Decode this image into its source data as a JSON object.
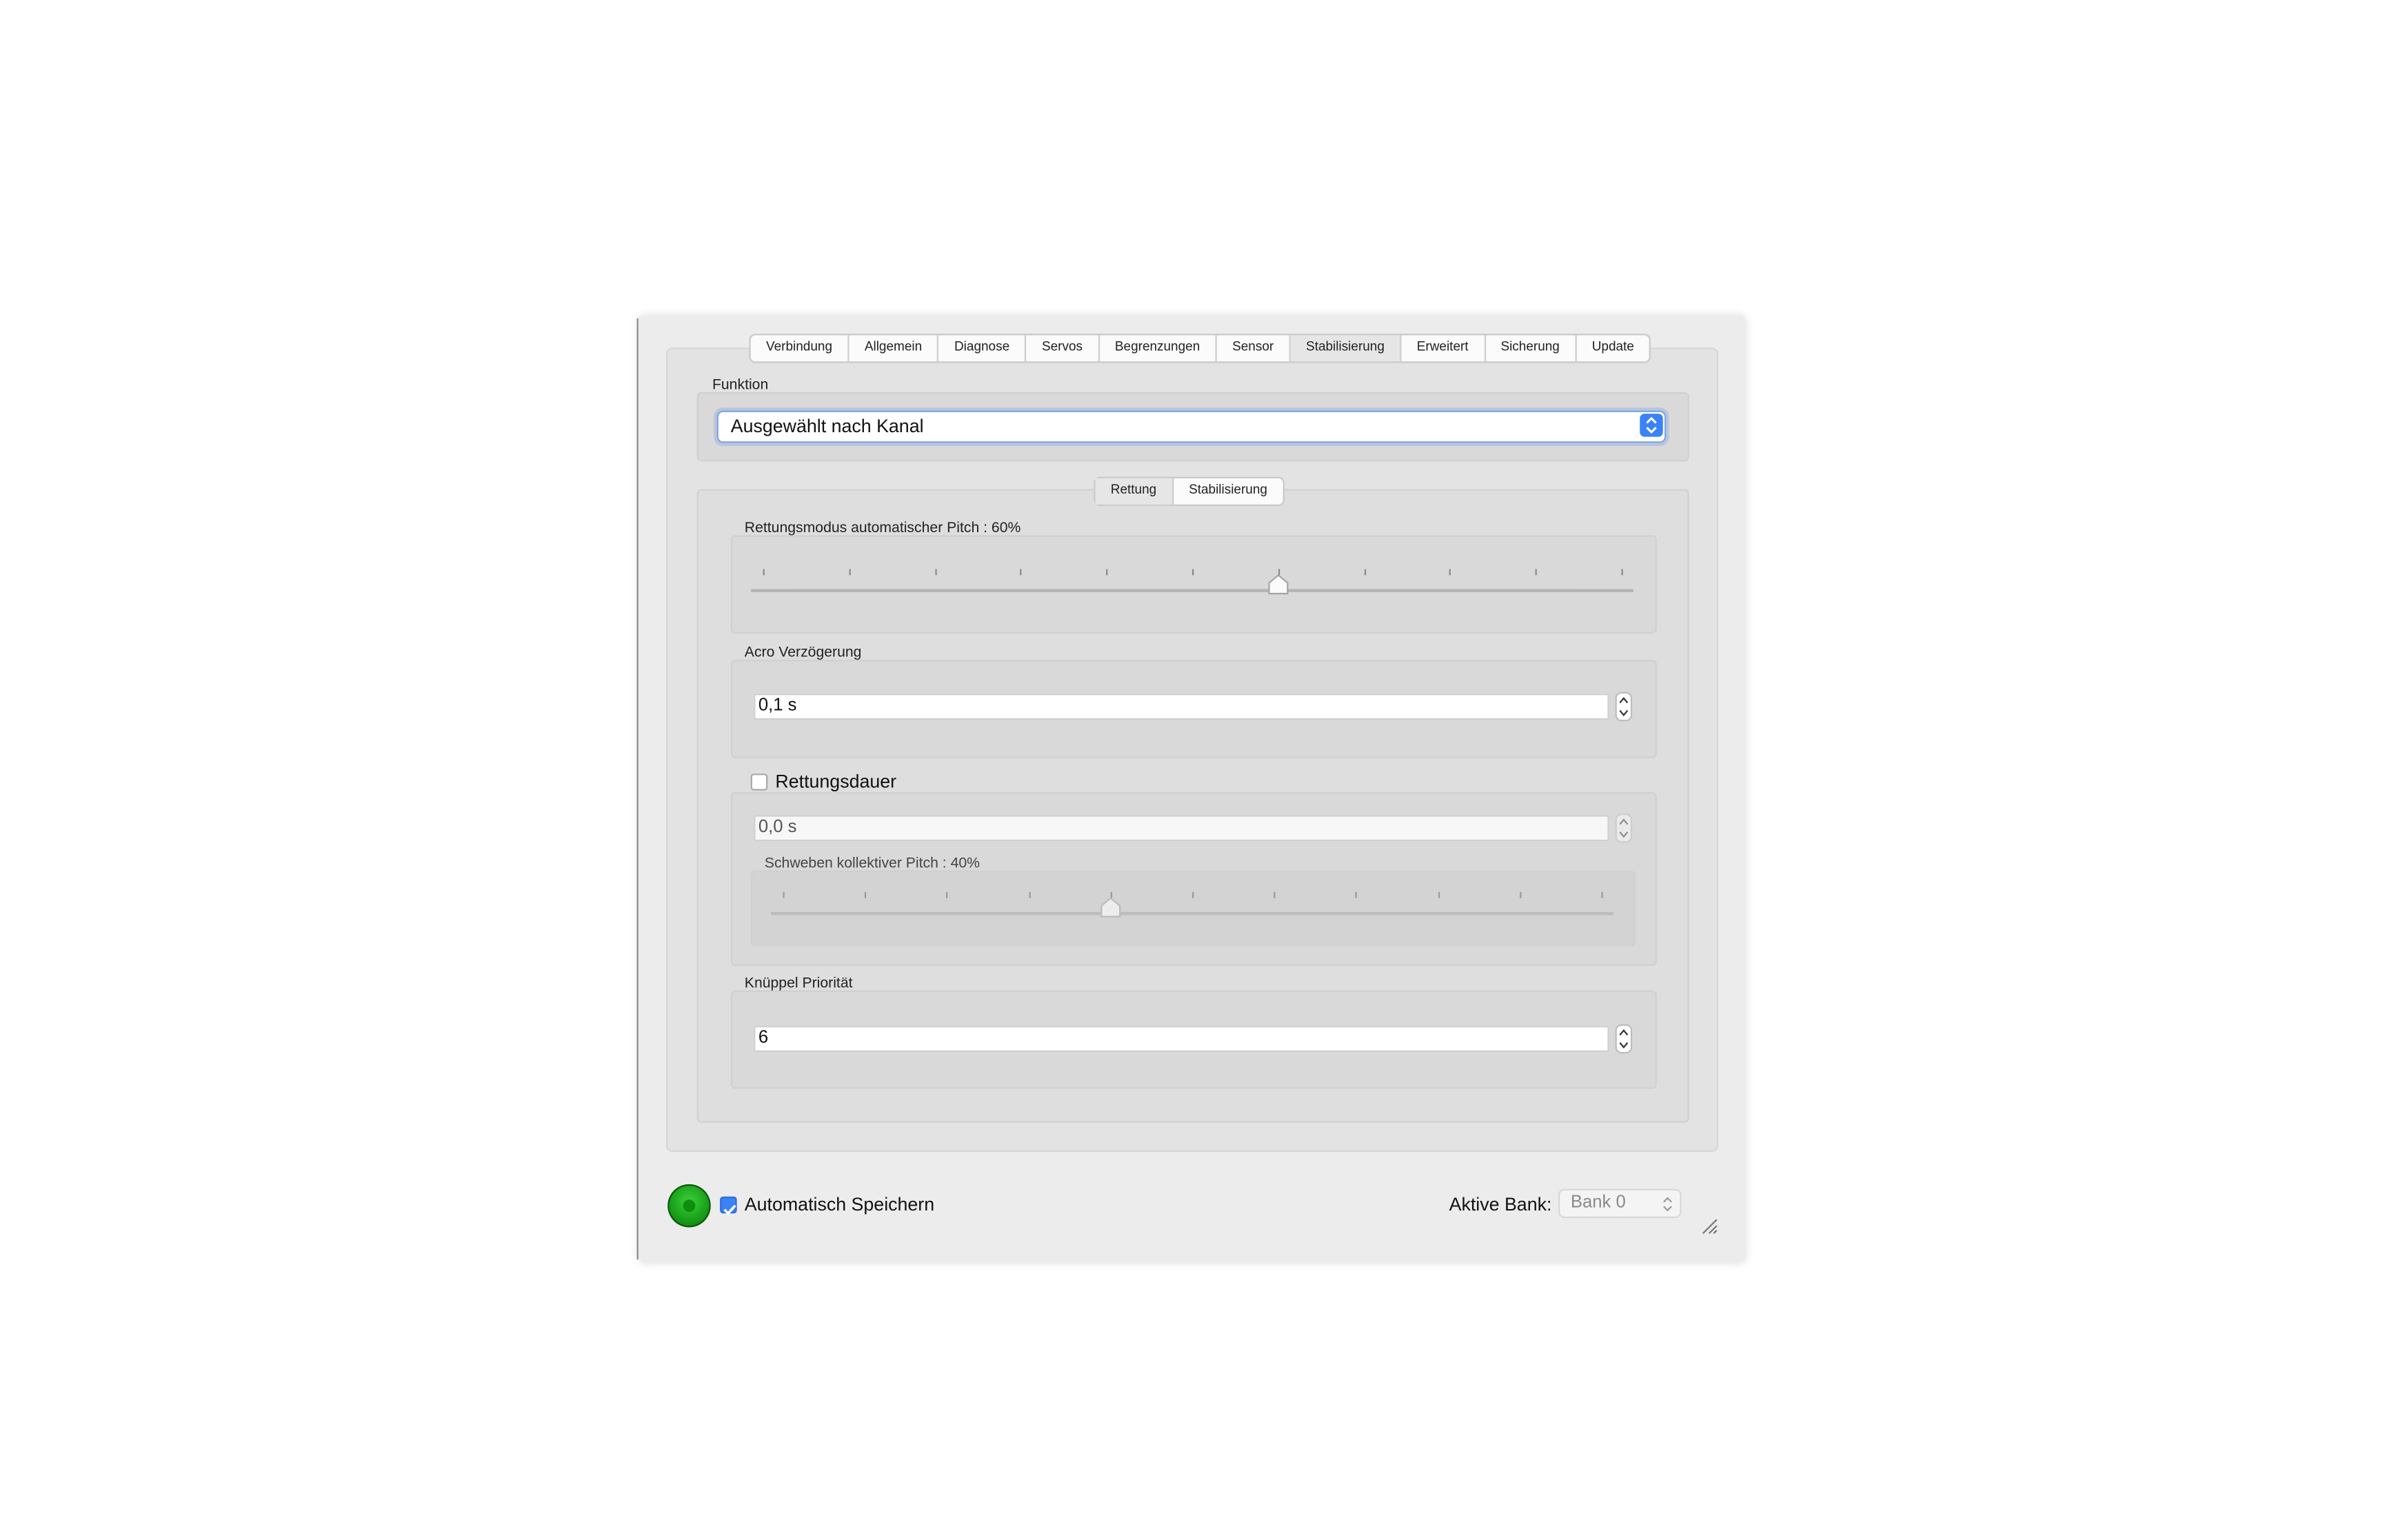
{
  "tabs": [
    "Verbindung",
    "Allgemein",
    "Diagnose",
    "Servos",
    "Begrenzungen",
    "Sensor",
    "Stabilisierung",
    "Erweitert",
    "Sicherung",
    "Update"
  ],
  "active_tab": "Stabilisierung",
  "funktion": {
    "label": "Funktion",
    "selected": "Ausgewählt nach Kanal"
  },
  "subtabs": [
    "Rettung",
    "Stabilisierung"
  ],
  "active_subtab": "Rettung",
  "rescue_pitch": {
    "label": "Rettungsmodus automatischer Pitch : 60%",
    "value_percent": 60
  },
  "acro_delay": {
    "label": "Acro Verzögerung",
    "value": "0,1 s"
  },
  "rescue_duration": {
    "label": "Rettungsdauer",
    "checked": false,
    "value": "0,0 s"
  },
  "hover_pitch": {
    "label": "Schweben kollektiver Pitch : 40%",
    "value_percent": 40
  },
  "stick_priority": {
    "label": "Knüppel Priorität",
    "value": "6"
  },
  "footer": {
    "autosave_label": "Automatisch Speichern",
    "autosave_checked": true,
    "active_bank_label": "Aktive Bank:",
    "active_bank_value": "Bank 0"
  },
  "colors": {
    "accent": "#3b82f6",
    "status_ok": "#1aa01a"
  }
}
